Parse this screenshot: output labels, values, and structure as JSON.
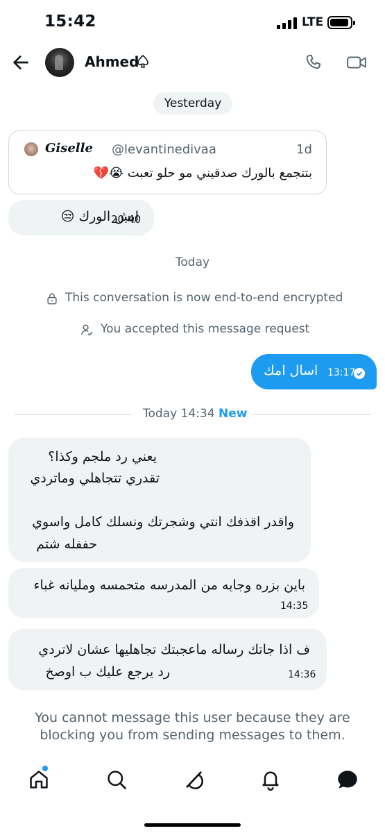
{
  "status_bar": {
    "time": "15:42",
    "network": "LTE"
  },
  "header": {
    "name": "Ahmed"
  },
  "day_yesterday": "Yesterday",
  "quoted_tweet": {
    "name": "𝑮𝒊𝒔𝒆𝒍𝒍𝒆",
    "handle": "@levantinedivaa",
    "time": "1d",
    "text": "بتتجمع بالورك صدقيني مو حلو تعبت 😭💔"
  },
  "msg_yesterday": {
    "text": "ايش الورك 😒",
    "time": "20:40"
  },
  "day_today": "Today",
  "encrypted_notice": "This conversation is now end-to-end encrypted",
  "request_notice": "You accepted this message request",
  "outgoing": {
    "text": "اسال امك",
    "time": "13:17"
  },
  "new_divider": {
    "label": "Today 14:34",
    "badge": "New"
  },
  "messages": [
    {
      "lines": [
        "يعني رد ملجم وكذا؟",
        "تقدري تتجاهلي وماتردي",
        "",
        "واقدر اقذفك انتي وشجرتك ونسلك كامل واسوي",
        "حففله شتم"
      ]
    },
    {
      "lines": [
        "باين بزره وجايه من المدرسه متحمسه ومليانه غباء"
      ],
      "time": "14:35"
    },
    {
      "lines": [
        "ف اذا جاتك رساله ماعجبتك تجاهليها عشان لاتردي",
        "رد يرجع عليك ب اوصخ"
      ],
      "time": "14:36"
    }
  ],
  "blocked_notice": {
    "line1": "You cannot message this user because they are",
    "line2": "blocking you from sending messages to them."
  },
  "colors": {
    "accent": "#1d9bf0",
    "bubble": "#eff3f4",
    "muted": "#536471"
  },
  "icons": [
    "back-arrow-icon",
    "spade-icon",
    "phone-icon",
    "video-icon",
    "lock-icon",
    "user-check-icon",
    "home-icon",
    "search-icon",
    "grok-icon",
    "bell-icon",
    "messages-icon"
  ]
}
